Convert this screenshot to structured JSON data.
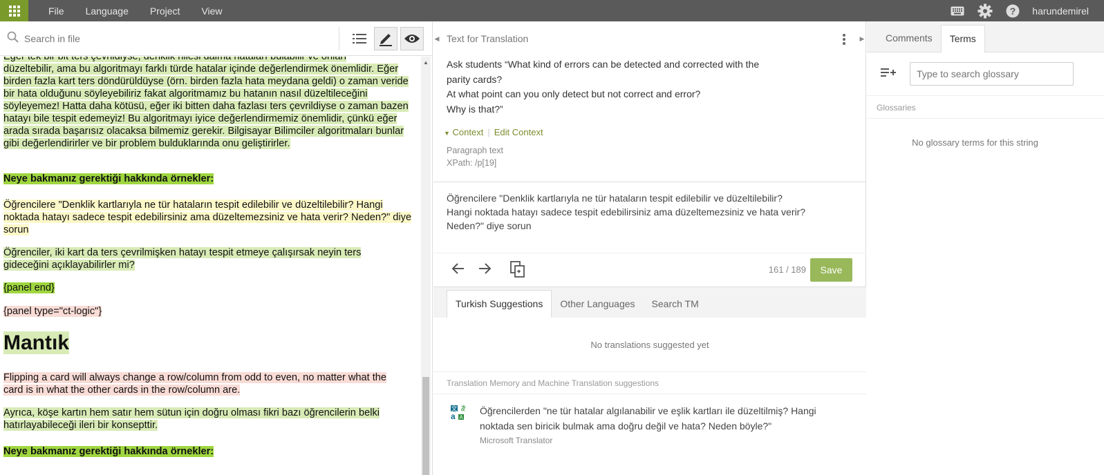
{
  "topbar": {
    "menu": [
      "File",
      "Language",
      "Project",
      "View"
    ],
    "username": "harundemirel",
    "accent": "#7a9a2c"
  },
  "left": {
    "search_placeholder": "Search in file",
    "document": [
      {
        "text": "Eğer tek bir bit ters çevrildiyse, denklik hilesi daima hataları bulabilir ve onları",
        "style": "hl"
      },
      {
        "text": "düzeltebilir, ama bu algoritmayı farklı türde hatalar içinde değerlendirmek önemlidir. Eğer birden fazla kart ters döndürüldüyse (örn. birden fazla hata meydana geldi) o zaman veride bir hata olduğunu söyleyebiliriz fakat algoritmamız bu hatanın nasıl düzeltileceğini söyleyemez! Hatta daha kötüsü, eğer iki bitten daha fazlası ters çevrildiyse o zaman bazen hatayı bile tespit edemeyiz! Bu algoritmayı iyice değerlendirmemiz önemlidir, çünkü eğer arada sırada başarısız olacaksa bilmemiz gerekir. Bilgisayar Bilimciler algoritmaları bunlar gibi değerlendirirler ve bir problem bulduklarında onu geliştirirler.",
        "style": "hl"
      },
      {
        "text": "Neye bakmanız gerektiği hakkında örnekler:",
        "style": "hlg"
      },
      {
        "text": "Öğrencilere \"Denklik kartlarıyla ne tür hataların tespit edilebilir ve düzeltilebilir? Hangi noktada hatayı sadece tespit edebilirsiniz ama düzeltemezsiniz ve hata verir? Neden?\" diye sorun",
        "style": "hly"
      },
      {
        "text": "Öğrenciler, iki kart da ters çevrilmişken hatayı tespit etmeye çalışırsak neyin ters gideceğini açıklayabilirler mi?",
        "style": "hl"
      },
      {
        "text": "{panel end}",
        "style": "hlg"
      },
      {
        "text": "{panel type=\"ct-logic\"}",
        "style": "hlr"
      },
      {
        "text": "Mantık",
        "style": "hl"
      },
      {
        "text": "Flipping a card will always change a row/column from odd to even, no matter what the card is in what the other cards in the row/column are.",
        "style": "hlr"
      },
      {
        "text": "Ayrıca, köşe kartın hem satır hem sütun için doğru olması fikri bazı öğrencilerin belki hatırlayabileceği ileri bir konsepttir.",
        "style": "hl"
      },
      {
        "text": "Neye bakmanız gerektiği hakkında örnekler:",
        "style": "hlg"
      }
    ]
  },
  "middle": {
    "header": "Text for Translation",
    "source": [
      "Ask students “What kind of errors can be detected and corrected with the",
      "parity cards?",
      "At what point can you only detect but not correct and error?",
      "Why is that?”"
    ],
    "context_label": "Context",
    "edit_context_label": "Edit Context",
    "meta_type": "Paragraph text",
    "meta_xpath": "XPath: /p[19]",
    "translation": [
      "Öğrencilere \"Denklik kartlarıyla ne tür hataların tespit edilebilir ve düzeltilebilir?",
      "Hangi noktada hatayı sadece tespit edebilirsiniz ama düzeltemezsiniz ve hata verir?",
      "Neden?\" diye sorun"
    ],
    "counter": "161 / 189",
    "save_label": "Save",
    "tabs": [
      "Turkish Suggestions",
      "Other Languages",
      "Search TM"
    ],
    "no_suggestions": "No translations suggested yet",
    "tm_header": "Translation Memory and Machine Translation suggestions",
    "tm_text": "Öğrencilerden \"ne tür hatalar algılanabilir ve eşlik kartları ile düzeltilmiş? Hangi noktada sen biricik bulmak ama doğru değil ve hata? Neden böyle?\"",
    "tm_source": "Microsoft Translator"
  },
  "right": {
    "tabs": [
      "Comments",
      "Terms"
    ],
    "glossary_placeholder": "Type to search glossary",
    "glossaries_label": "Glossaries",
    "no_terms": "No glossary terms for this string"
  }
}
